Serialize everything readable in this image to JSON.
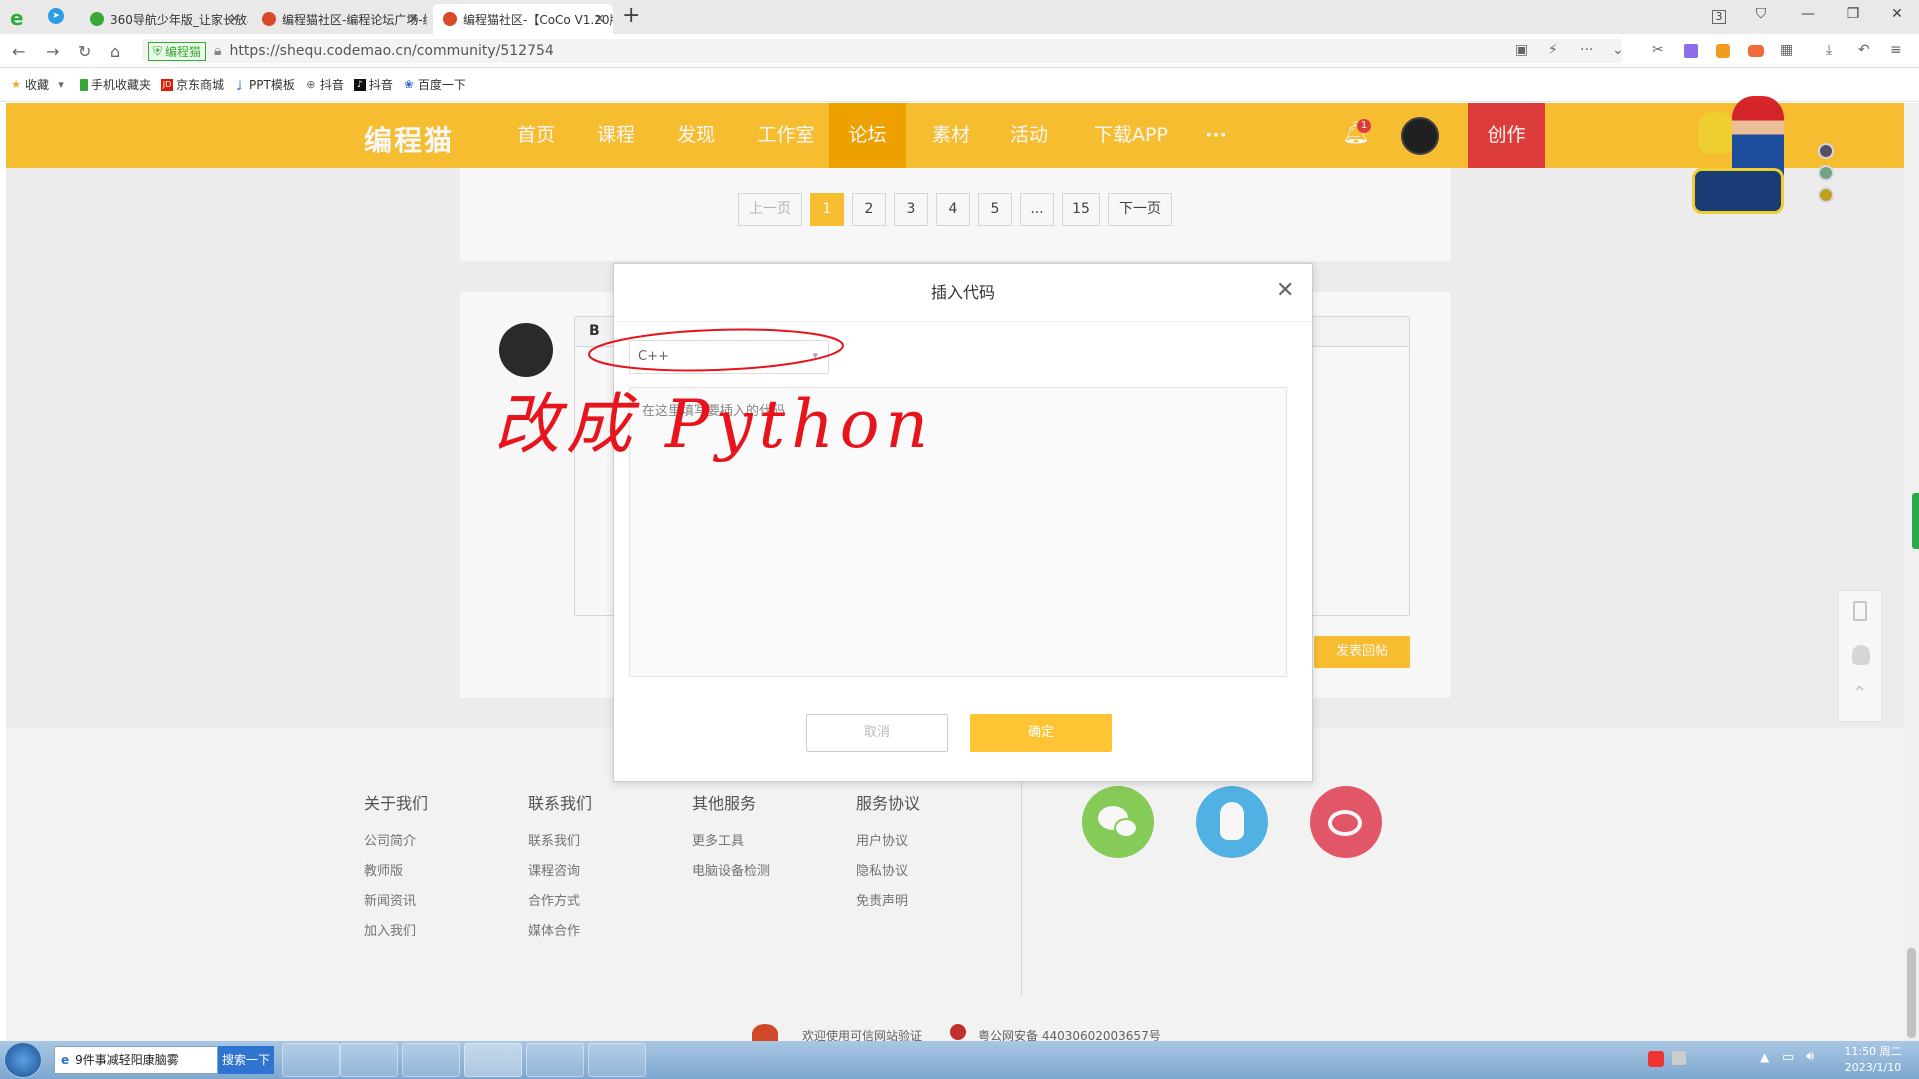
{
  "browser": {
    "tabs": [
      {
        "title": "360导航少年版_让家长放心，",
        "fav_color": "#3aa835"
      },
      {
        "title": "编程猫社区-编程论坛广场-编",
        "fav_color": "#d94a2b"
      },
      {
        "title": "编程猫社区-【CoCo V1.20版",
        "fav_color": "#d94a2b"
      }
    ],
    "tab_count_badge": "3",
    "url_badge": "编程猫",
    "url": "https://shequ.codemao.cn/community/512754",
    "bookmarks": [
      "收藏",
      "手机收藏夹",
      "京东商城",
      "PPT模板",
      "抖音",
      "抖音",
      "百度一下"
    ]
  },
  "site": {
    "logo": "编程猫",
    "nav": [
      "首页",
      "课程",
      "发现",
      "工作室",
      "论坛",
      "素材",
      "活动",
      "下载APP",
      "···"
    ],
    "active_nav": "论坛",
    "notification_count": "1",
    "create_label": "创作"
  },
  "pagination": {
    "prev": "上一页",
    "pages": [
      "1",
      "2",
      "3",
      "4",
      "5",
      "...",
      "15"
    ],
    "next": "下一页",
    "current": "1"
  },
  "reply": {
    "editor_bold": "B",
    "submit_label": "发表回帖"
  },
  "modal": {
    "title": "插入代码",
    "language_value": "C++",
    "code_placeholder": "在这里填写要插入的代码",
    "cancel_label": "取消",
    "confirm_label": "确定"
  },
  "annotation": {
    "text": "改成 Python",
    "color": "#e8141c"
  },
  "footer": {
    "columns": [
      {
        "heading": "关于我们",
        "links": [
          "公司简介",
          "教师版",
          "新闻资讯",
          "加入我们"
        ]
      },
      {
        "heading": "联系我们",
        "links": [
          "联系我们",
          "课程咨询",
          "合作方式",
          "媒体合作"
        ]
      },
      {
        "heading": "其他服务",
        "links": [
          "更多工具",
          "电脑设备检测"
        ]
      },
      {
        "heading": "服务协议",
        "links": [
          "用户协议",
          "隐私协议",
          "免责声明"
        ]
      }
    ],
    "social": [
      {
        "name": "wechat",
        "color": "#8bd15a"
      },
      {
        "name": "qq",
        "color": "#54b7eb"
      },
      {
        "name": "weibo",
        "color": "#ea5a6b"
      }
    ],
    "bottom_line_1": "欢迎使用可信网站验证",
    "bottom_line_2": "粤公网安备 44030602003657号"
  },
  "taskbar": {
    "search_value": "9件事减轻阳康脑雾",
    "search_button": "搜索一下",
    "clock_time": "11:50 周二",
    "clock_date": "2023/1/10"
  }
}
